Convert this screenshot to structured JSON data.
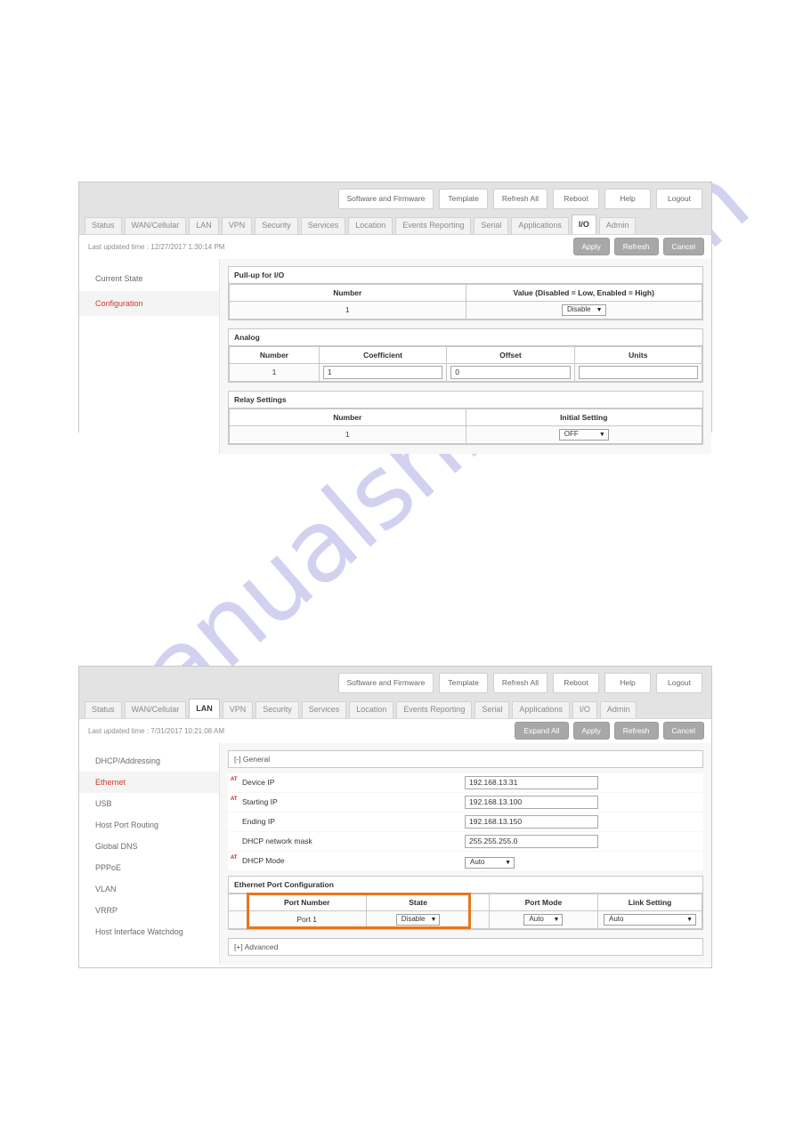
{
  "watermark": {
    "text": "manualshive.com"
  },
  "panels": [
    {
      "id": "io",
      "global_buttons": [
        {
          "label": "Software and Firmware"
        },
        {
          "label": "Template"
        },
        {
          "label": "Refresh All"
        },
        {
          "label": "Reboot"
        },
        {
          "label": "Help"
        },
        {
          "label": "Logout"
        }
      ],
      "tabs": [
        {
          "label": "Status",
          "active": false
        },
        {
          "label": "WAN/Cellular",
          "active": false
        },
        {
          "label": "LAN",
          "active": false
        },
        {
          "label": "VPN",
          "active": false
        },
        {
          "label": "Security",
          "active": false
        },
        {
          "label": "Services",
          "active": false
        },
        {
          "label": "Location",
          "active": false
        },
        {
          "label": "Events Reporting",
          "active": false
        },
        {
          "label": "Serial",
          "active": false
        },
        {
          "label": "Applications",
          "active": false
        },
        {
          "label": "I/O",
          "active": true
        },
        {
          "label": "Admin",
          "active": false
        }
      ],
      "last_updated": "Last updated time : 12/27/2017 1:30:14 PM",
      "actions": [
        {
          "label": "Apply"
        },
        {
          "label": "Refresh"
        },
        {
          "label": "Cancel"
        }
      ],
      "sidebar": [
        {
          "label": "Current State",
          "active": false
        },
        {
          "label": "Configuration",
          "active": true
        }
      ],
      "sections": {
        "pullup": {
          "title": "Pull-up for I/O",
          "headers": [
            "Number",
            "Value (Disabled = Low, Enabled = High)"
          ],
          "row": {
            "number": "1",
            "value_select": "Disable"
          }
        },
        "analog": {
          "title": "Analog",
          "headers": [
            "Number",
            "Coefficient",
            "Offset",
            "Units"
          ],
          "row": {
            "number": "1",
            "coefficient": "1",
            "offset": "0",
            "units": ""
          }
        },
        "relay": {
          "title": "Relay Settings",
          "headers": [
            "Number",
            "Initial Setting"
          ],
          "row": {
            "number": "1",
            "initial_select": "OFF"
          }
        }
      }
    },
    {
      "id": "lan",
      "global_buttons": [
        {
          "label": "Software and Firmware"
        },
        {
          "label": "Template"
        },
        {
          "label": "Refresh All"
        },
        {
          "label": "Reboot"
        },
        {
          "label": "Help"
        },
        {
          "label": "Logout"
        }
      ],
      "tabs": [
        {
          "label": "Status",
          "active": false
        },
        {
          "label": "WAN/Cellular",
          "active": false
        },
        {
          "label": "LAN",
          "active": true
        },
        {
          "label": "VPN",
          "active": false
        },
        {
          "label": "Security",
          "active": false
        },
        {
          "label": "Services",
          "active": false
        },
        {
          "label": "Location",
          "active": false
        },
        {
          "label": "Events Reporting",
          "active": false
        },
        {
          "label": "Serial",
          "active": false
        },
        {
          "label": "Applications",
          "active": false
        },
        {
          "label": "I/O",
          "active": false
        },
        {
          "label": "Admin",
          "active": false
        }
      ],
      "last_updated": "Last updated time : 7/31/2017 10:21:08 AM",
      "actions": [
        {
          "label": "Expand All"
        },
        {
          "label": "Apply"
        },
        {
          "label": "Refresh"
        },
        {
          "label": "Cancel"
        }
      ],
      "sidebar": [
        {
          "label": "DHCP/Addressing",
          "active": false
        },
        {
          "label": "Ethernet",
          "active": true
        },
        {
          "label": "USB",
          "active": false
        },
        {
          "label": "Host Port Routing",
          "active": false
        },
        {
          "label": "Global DNS",
          "active": false
        },
        {
          "label": "PPPoE",
          "active": false
        },
        {
          "label": "VLAN",
          "active": false
        },
        {
          "label": "VRRP",
          "active": false
        },
        {
          "label": "Host Interface Watchdog",
          "active": false
        }
      ],
      "general": {
        "header": "[-] General",
        "fields": [
          {
            "at": "AT",
            "label": "Device IP",
            "value": "192.168.13.31",
            "type": "text"
          },
          {
            "at": "AT",
            "label": "Starting IP",
            "value": "192.168.13.100",
            "type": "text"
          },
          {
            "at": "",
            "label": "Ending IP",
            "value": "192.168.13.150",
            "type": "text"
          },
          {
            "at": "",
            "label": "DHCP network mask",
            "value": "255.255.255.0",
            "type": "text"
          },
          {
            "at": "AT",
            "label": "DHCP Mode",
            "value": "Auto",
            "type": "select"
          }
        ]
      },
      "port_config": {
        "title": "Ethernet Port Configuration",
        "headers": [
          "Port Number",
          "State",
          "Port Mode",
          "Link Setting"
        ],
        "row": {
          "port_number": "Port 1",
          "state": "Disable",
          "port_mode": "Auto",
          "link_setting": "Auto"
        }
      },
      "advanced": {
        "header": "[+] Advanced"
      }
    }
  ],
  "colors": {
    "accent_orange": "#e8761a",
    "active_red": "#d03a28",
    "band_grey": "#e3e3e3",
    "button_grey": "#a8a8a8"
  }
}
